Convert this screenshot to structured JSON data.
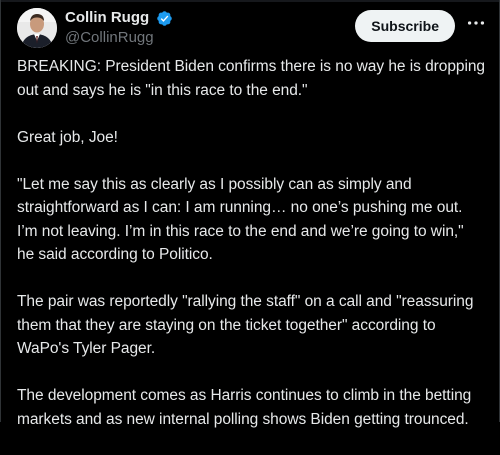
{
  "author": {
    "display_name": "Collin Rugg",
    "handle": "@CollinRugg",
    "verified": true,
    "avatar_icon": "person-avatar",
    "verified_icon": "verified-badge-icon",
    "verified_color": "#1d9bf0"
  },
  "actions": {
    "subscribe_label": "Subscribe",
    "more_icon": "more-horizontal-icon"
  },
  "tweet": {
    "paragraphs": [
      "BREAKING: President Biden confirms there is no way he is dropping out and says he is \"in this race to the end.\"",
      "Great job, Joe!",
      "\"Let me say this as clearly as I possibly can as simply and straightforward as I can: I am running… no one’s pushing me out. I’m not leaving. I’m in this race to the end and we’re going to win,\" he said according to Politico.",
      "The pair was reportedly \"rallying the staff\" on a call and \"reassuring them that they are staying on the ticket together\" according to WaPo's Tyler Pager.",
      "The development comes as Harris continues to climb in the betting markets and as new internal polling shows Biden getting trounced."
    ]
  },
  "colors": {
    "background": "#000000",
    "text": "#e7e9ea",
    "muted": "#71767b",
    "button_bg": "#eff3f4",
    "button_text": "#0f1419"
  }
}
